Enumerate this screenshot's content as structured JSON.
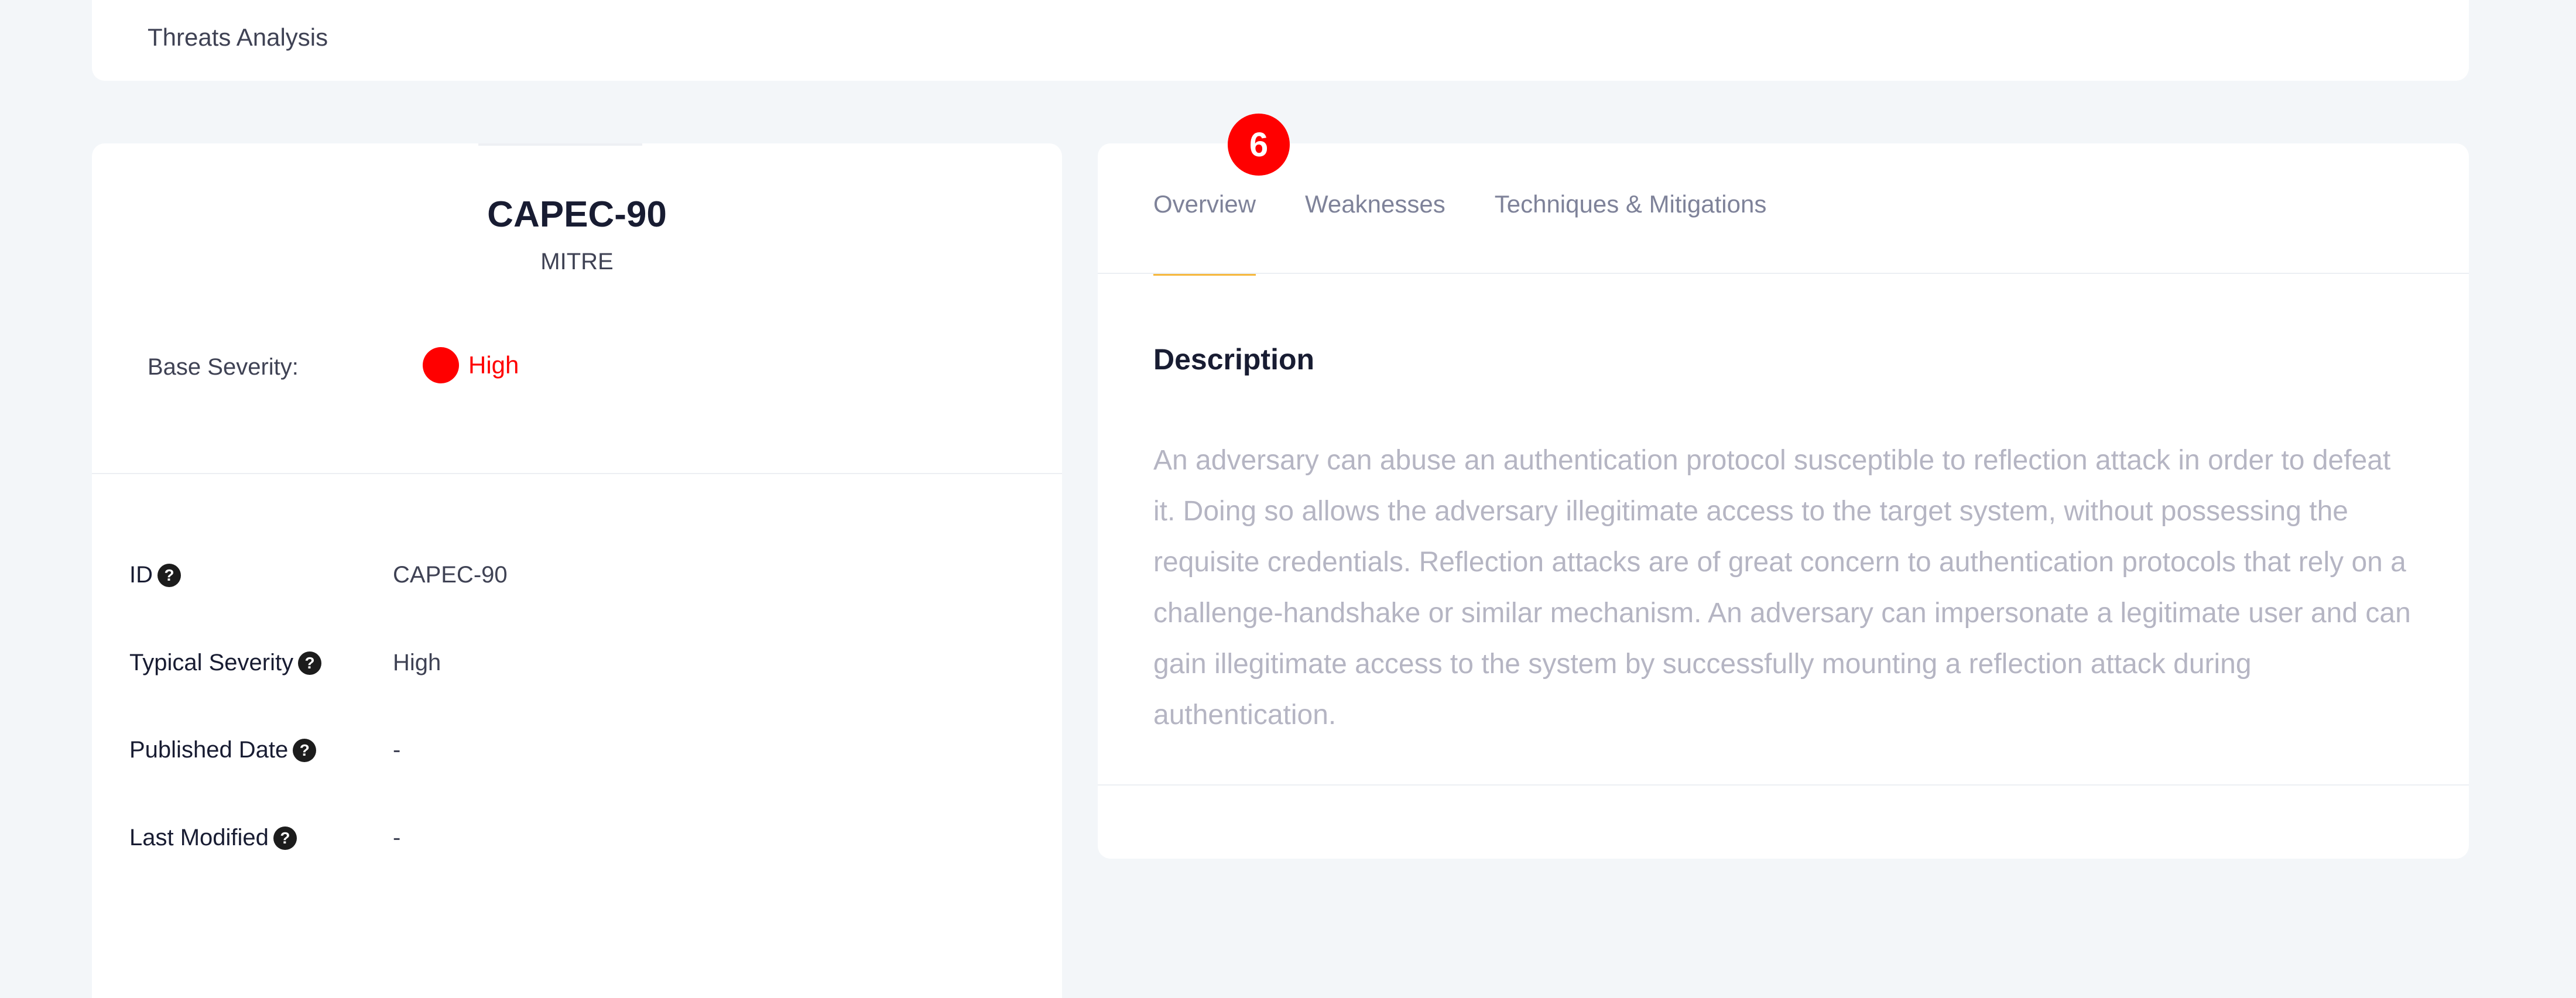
{
  "breadcrumb": {
    "title": "Threats Analysis"
  },
  "threat": {
    "title": "CAPEC-90",
    "source": "MITRE",
    "base_severity_label": "Base Severity:",
    "base_severity_value": "High",
    "severity_color": "#ff0000"
  },
  "details": [
    {
      "label": "ID",
      "value": "CAPEC-90"
    },
    {
      "label": "Typical Severity",
      "value": "High"
    },
    {
      "label": "Published Date",
      "value": "-"
    },
    {
      "label": "Last Modified",
      "value": "-"
    }
  ],
  "help_icon_glyph": "?",
  "tabs": [
    {
      "label": "Overview",
      "active": true
    },
    {
      "label": "Weaknesses",
      "active": false
    },
    {
      "label": "Techniques & Mitigations",
      "active": false
    }
  ],
  "badge": {
    "value": "6"
  },
  "description": {
    "heading": "Description",
    "text": "An adversary can abuse an authentication protocol susceptible to reflection attack in order to defeat it. Doing so allows the adversary illegitimate access to the target system, without possessing the requisite credentials. Reflection attacks are of great concern to authentication protocols that rely on a challenge-handshake or similar mechanism. An adversary can impersonate a legitimate user and can gain illegitimate access to the system by successfully mounting a reflection attack during authentication."
  },
  "colors": {
    "accent_tab_underline": "#f6b73c",
    "badge": "#ff0000",
    "background": "#f3f6f9"
  }
}
